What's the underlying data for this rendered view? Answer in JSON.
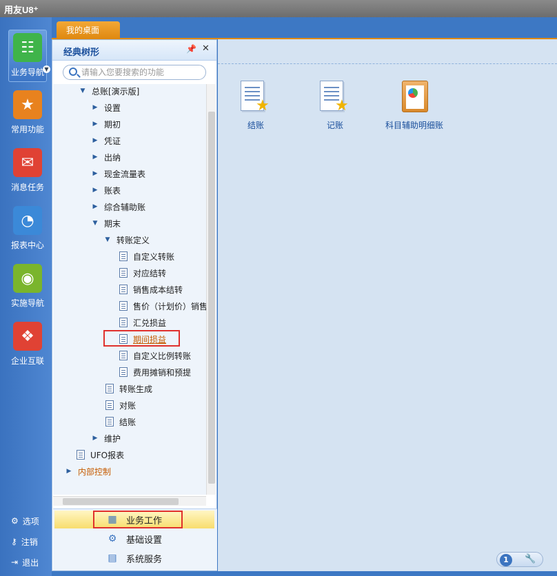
{
  "app": {
    "title": "用友U8⁺"
  },
  "left_nav": {
    "items": [
      {
        "label": "业务导航",
        "icon": "tree-icon",
        "color": "#3fb44a"
      },
      {
        "label": "常用功能",
        "icon": "star-icon",
        "color": "#e8821e"
      },
      {
        "label": "消息任务",
        "icon": "mail-icon",
        "color": "#e04234"
      },
      {
        "label": "报表中心",
        "icon": "report-icon",
        "color": "#3b89d8"
      },
      {
        "label": "实施导航",
        "icon": "compass-icon",
        "color": "#7ab52c"
      },
      {
        "label": "企业互联",
        "icon": "network-icon",
        "color": "#e04234"
      }
    ],
    "bottom": [
      {
        "label": "选项",
        "icon": "gear-icon"
      },
      {
        "label": "注销",
        "icon": "key-icon"
      },
      {
        "label": "退出",
        "icon": "exit-icon"
      }
    ]
  },
  "tab": {
    "label": "我的桌面"
  },
  "tree": {
    "title": "经典树形",
    "search_placeholder": "请输入您要搜索的功能",
    "nodes": [
      "总账[演示版]",
      "设置",
      "期初",
      "凭证",
      "出纳",
      "现金流量表",
      "账表",
      "综合辅助账",
      "期末",
      "转账定义",
      "自定义转账",
      "对应结转",
      "销售成本结转",
      "售价（计划价）销售",
      "汇兑损益",
      "期间损益",
      "自定义比例转账",
      "费用摊销和预提",
      "转账生成",
      "对账",
      "结账",
      "维护",
      "UFO报表",
      "内部控制"
    ]
  },
  "bottom_menu": {
    "items": [
      "业务工作",
      "基础设置",
      "系统服务"
    ]
  },
  "desktop": {
    "tiles": [
      "结账",
      "记账",
      "科目辅助明细账"
    ]
  },
  "status": {
    "page": "1"
  }
}
